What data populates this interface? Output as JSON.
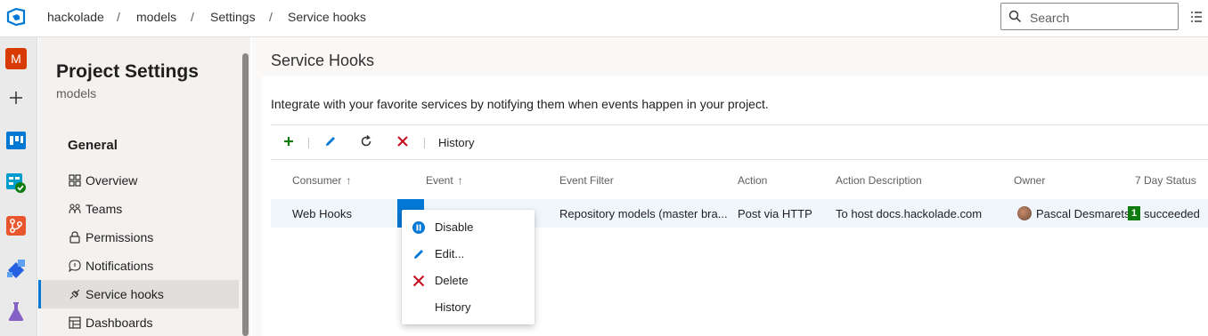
{
  "breadcrumb": {
    "org": "hackolade",
    "project": "models",
    "section": "Settings",
    "page": "Service hooks",
    "separator": "/"
  },
  "search": {
    "placeholder": "Search"
  },
  "rail": {
    "avatar_initial": "M",
    "icons": [
      "add-icon",
      "boards-icon",
      "pipelines-check-icon",
      "repos-icon",
      "artifacts-icon",
      "test-plans-flask-icon"
    ]
  },
  "settings": {
    "title": "Project Settings",
    "subtitle": "models",
    "group": "General",
    "items": [
      {
        "label": "Overview",
        "icon": "overview-icon"
      },
      {
        "label": "Teams",
        "icon": "teams-icon"
      },
      {
        "label": "Permissions",
        "icon": "lock-icon"
      },
      {
        "label": "Notifications",
        "icon": "notification-bubble-icon"
      },
      {
        "label": "Service hooks",
        "icon": "plug-icon",
        "selected": true
      },
      {
        "label": "Dashboards",
        "icon": "dashboard-icon"
      }
    ]
  },
  "main": {
    "title": "Service Hooks",
    "description": "Integrate with your favorite services by notifying them when events happen in your project.",
    "toolbar": {
      "history_label": "History"
    },
    "columns": {
      "consumer": "Consumer",
      "event": "Event",
      "event_filter": "Event Filter",
      "action": "Action",
      "action_description": "Action Description",
      "owner": "Owner",
      "status": "7 Day Status",
      "sort_arrow": "↑"
    },
    "rows": [
      {
        "consumer": "Web Hooks",
        "event_filter": "Repository models (master bra...",
        "action": "Post via HTTP",
        "action_description": "To host docs.hackolade.com",
        "owner": "Pascal Desmarets",
        "status_count": "1",
        "status_text": "succeeded"
      }
    ]
  },
  "context_menu": {
    "items": [
      {
        "label": "Disable",
        "icon": "pause-icon"
      },
      {
        "label": "Edit...",
        "icon": "pencil-icon"
      },
      {
        "label": "Delete",
        "icon": "delete-x-icon"
      },
      {
        "label": "History",
        "icon": ""
      }
    ]
  },
  "colors": {
    "accent": "#0078d4",
    "success": "#107c10",
    "danger": "#a4262c",
    "add_green": "#107c10"
  }
}
